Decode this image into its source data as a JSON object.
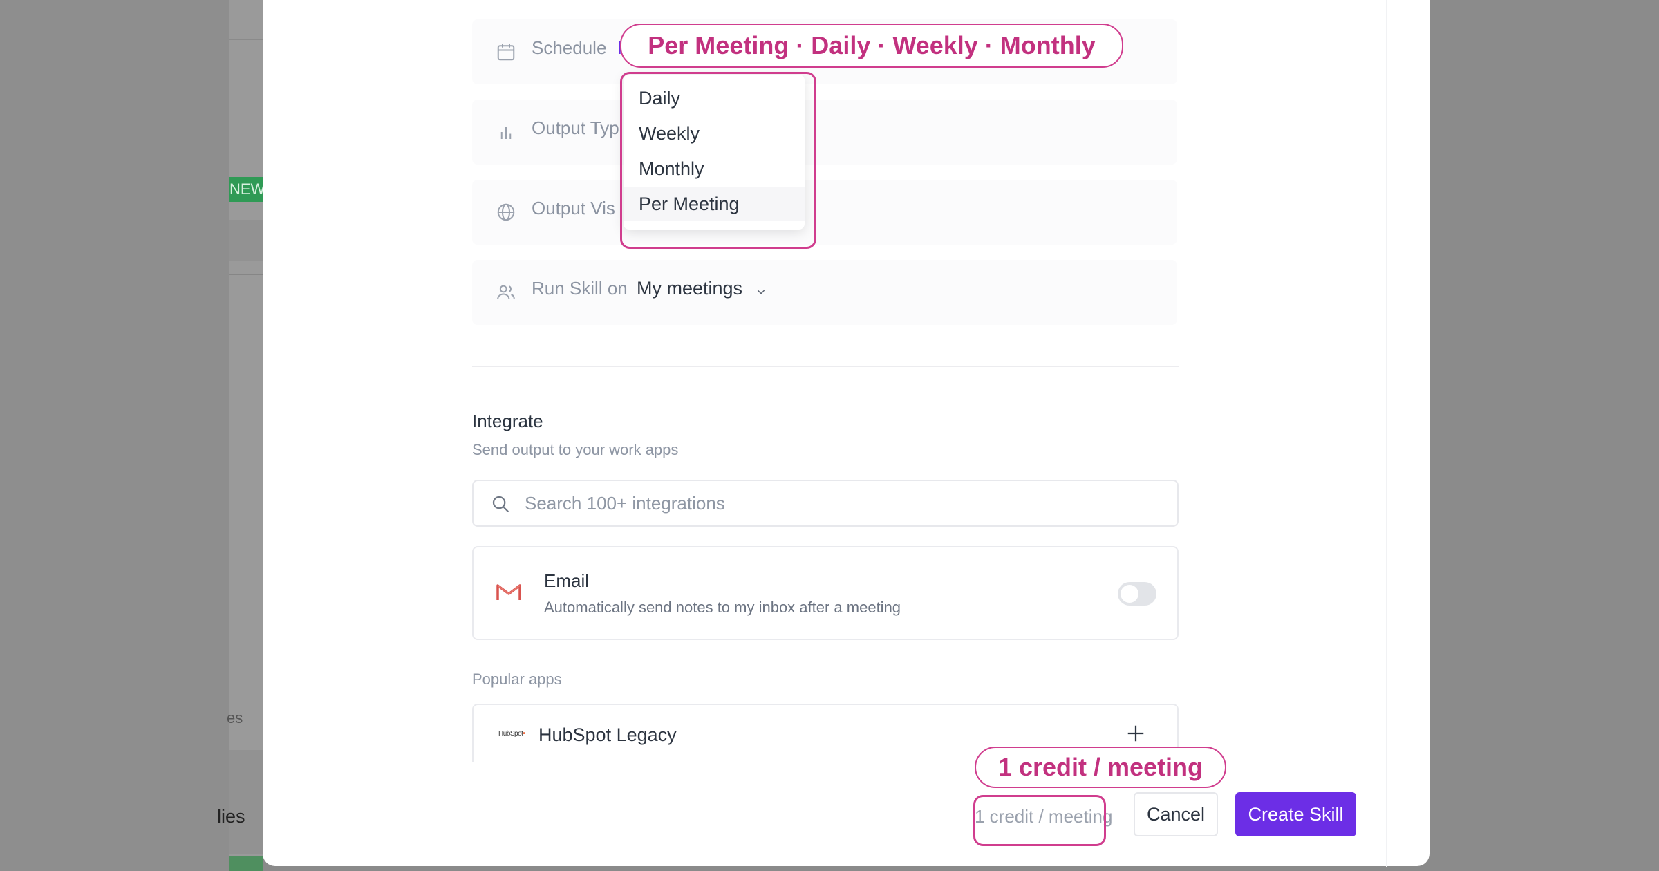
{
  "background": {
    "badge": "NEW",
    "partial_text_1": "es",
    "partial_text_2": "lies"
  },
  "settings": {
    "schedule": {
      "label": "Schedule",
      "value": "P",
      "icon": "calendar-icon"
    },
    "output_type": {
      "label": "Output Typ",
      "icon": "bar-chart-icon"
    },
    "output_visibility": {
      "label": "Output Vis",
      "icon": "globe-icon"
    },
    "run_skill_on": {
      "label": "Run Skill on",
      "value": "My meetings",
      "icon": "users-icon"
    }
  },
  "schedule_dropdown": {
    "options": [
      "Daily",
      "Weekly",
      "Monthly",
      "Per Meeting"
    ],
    "selected": "Per Meeting"
  },
  "integrate": {
    "title": "Integrate",
    "subtitle": "Send output to your work apps",
    "search_placeholder": "Search 100+ integrations",
    "email": {
      "title": "Email",
      "description": "Automatically send notes to my inbox after a meeting",
      "enabled": false
    },
    "popular_label": "Popular apps",
    "popular_apps": [
      {
        "logo_text": "HubSpot",
        "name": "HubSpot Legacy"
      }
    ]
  },
  "footer": {
    "credit_text": "1 credit / meeting",
    "cancel_label": "Cancel",
    "create_label": "Create Skill"
  },
  "annotations": {
    "schedule_callout": "Per Meeting · Daily · Weekly · Monthly",
    "credit_callout": "1 credit / meeting"
  },
  "colors": {
    "primary": "#6c2ee6",
    "highlight": "#d03d8e",
    "badge": "#2f9a55"
  }
}
